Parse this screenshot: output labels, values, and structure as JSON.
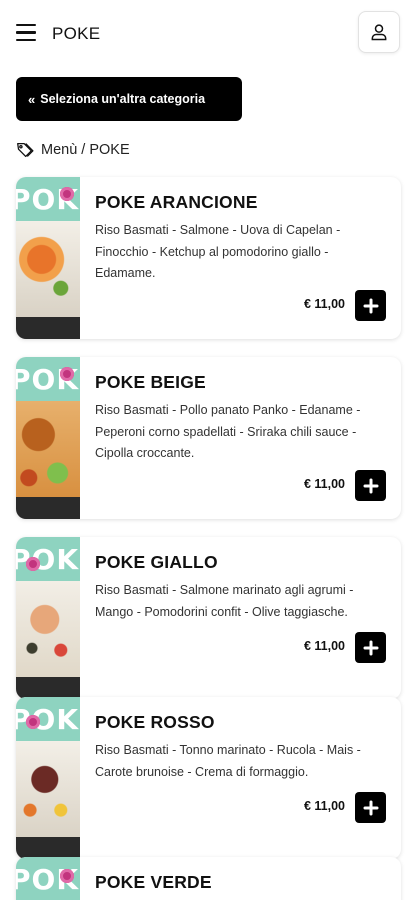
{
  "header": {
    "title": "POKE",
    "menu_icon": "hamburger-menu-icon",
    "user_icon": "user-icon"
  },
  "back_button": {
    "icon": "double-chevron-left-icon",
    "label": "Seleziona un'altra categoria"
  },
  "breadcrumb": {
    "icon": "tag-icon",
    "text": "Menù / POKE"
  },
  "products": [
    {
      "name": "POKE ARANCIONE",
      "description": "Riso Basmati - Salmone - Uova di Capelan - Finocchio - Ketchup al pomodorino giallo - Edamame.",
      "price": "€ 11,00"
    },
    {
      "name": "POKE BEIGE",
      "description": "Riso Basmati - Pollo panato Panko - Edaname - Peperoni corno spadellati - Sriraka chili sauce - Cipolla croccante.",
      "price": "€ 11,00"
    },
    {
      "name": "POKE GIALLO",
      "description": "Riso Basmati - Salmone marinato agli agrumi - Mango - Pomodorini confit - Olive taggiasche.",
      "price": "€ 11,00"
    },
    {
      "name": "POKE ROSSO",
      "description": "Riso Basmati - Tonno marinato - Rucola - Mais - Carote brunoise - Crema di formaggio.",
      "price": "€ 11,00"
    },
    {
      "name": "POKE VERDE",
      "description": "",
      "price": ""
    }
  ],
  "thumb_word": "POKE",
  "colors": {
    "accent": "#000000",
    "thumb_band": "#8ed3c0",
    "flower": "#c2347e"
  }
}
